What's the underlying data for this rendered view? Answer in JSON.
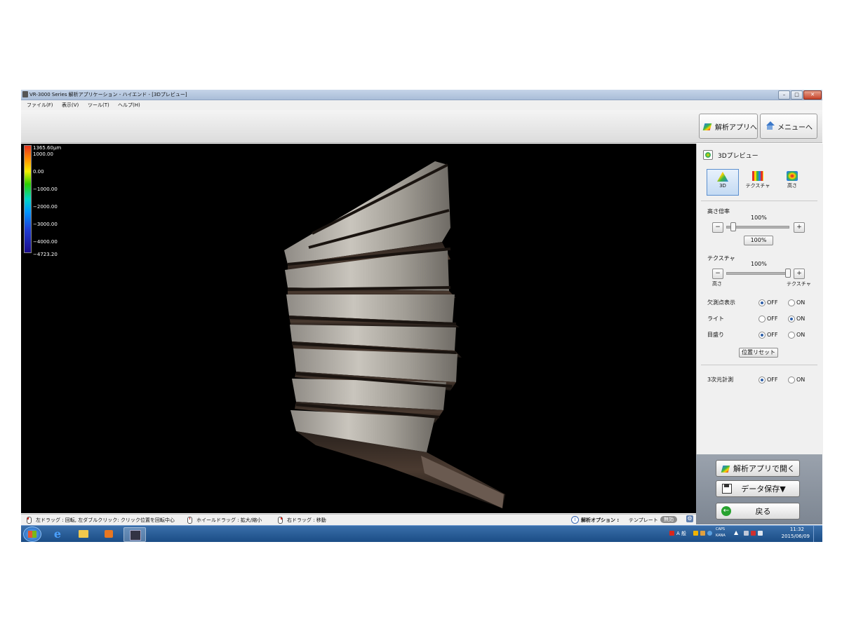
{
  "window": {
    "title": "VR-3000 Series 解析アプリケーション - ハイエンド - [3Dプレビュー]",
    "minimize": "–",
    "maximize": "□",
    "close": "✕"
  },
  "menu": [
    "ファイル(F)",
    "表示(V)",
    "ツール(T)",
    "ヘルプ(H)"
  ],
  "toolbar": {
    "analysis_app_label": "解析アプリへ",
    "menu_label": "メニューへ"
  },
  "colorbar": {
    "labels": [
      "1365.60μm",
      "1000.00",
      "0.00",
      "−1000.00",
      "−2000.00",
      "−3000.00",
      "−4000.00",
      "−4723.20"
    ]
  },
  "hints": {
    "left_drag": "左ドラッグ : 回転, 左ダブルクリック: クリック位置を回転中心",
    "wheel_drag": "ホイールドラッグ : 拡大/縮小",
    "right_drag": "右ドラッグ : 移動",
    "analysis_option_label": "解析オプション :",
    "template_label": "テンプレート",
    "template_status": "無効"
  },
  "panel": {
    "title": "3Dプレビュー",
    "modes": [
      {
        "label": "3D",
        "selected": true
      },
      {
        "label": "テクスチャ",
        "selected": false
      },
      {
        "label": "高さ",
        "selected": false
      }
    ],
    "height_scale": {
      "label": "高さ倍率",
      "value": "100%",
      "level": 0.1,
      "reset_button": "100%",
      "minus": "−",
      "plus": "+"
    },
    "texture": {
      "label": "テクスチャ",
      "value": "100%",
      "level": 1.0,
      "left_label": "高さ",
      "right_label": "テクスチャ",
      "minus": "−",
      "plus": "+"
    },
    "missing_points": {
      "label": "欠測点表示",
      "off": "OFF",
      "on": "ON",
      "selected": "OFF"
    },
    "light": {
      "label": "ライト",
      "off": "OFF",
      "on": "ON",
      "selected": "ON"
    },
    "scale": {
      "label": "目盛り",
      "off": "OFF",
      "on": "ON",
      "selected": "OFF"
    },
    "position_reset": "位置リセット",
    "measure3d": {
      "label": "3次元計測",
      "off": "OFF",
      "on": "ON",
      "selected": "OFF"
    }
  },
  "actions": {
    "open_in_app": "解析アプリで開く",
    "save_data": "データ保存▼",
    "back": "戻る"
  },
  "taskbar": {
    "tray_ime": "A 般",
    "caps": "CAPS",
    "kana": "KANA",
    "time": "11:32",
    "date": "2015/06/09"
  },
  "colors": {
    "viewport_bg": "#000000",
    "taskbar": "#1b4d86",
    "accent": "#2e5fa8"
  }
}
